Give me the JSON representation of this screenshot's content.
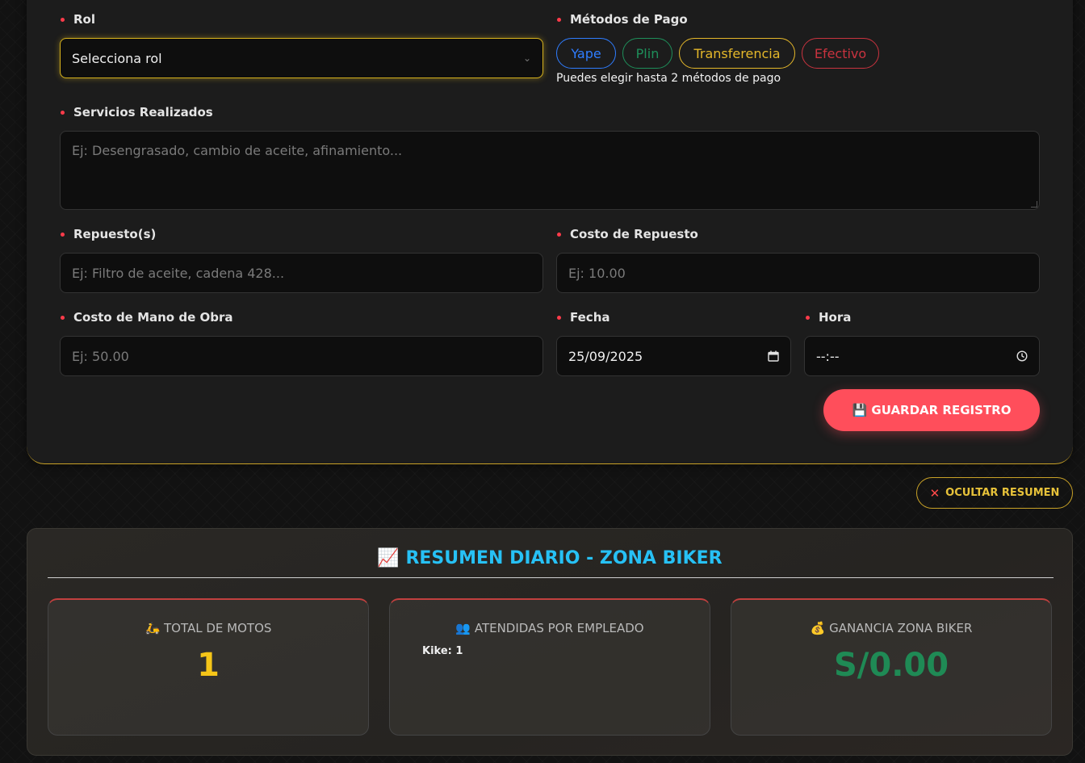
{
  "form": {
    "rol_label": "Rol",
    "rol_value": "Selecciona rol",
    "pago_label": "Métodos de Pago",
    "pago_options": [
      {
        "label": "Yape",
        "color": "#2f7dff"
      },
      {
        "label": "Plin",
        "color": "#1e8f5a"
      },
      {
        "label": "Transferencia",
        "color": "#e5b82a"
      },
      {
        "label": "Efectivo",
        "color": "#c9333f"
      }
    ],
    "pago_hint": "Puedes elegir hasta 2 métodos de pago",
    "servicios_label": "Servicios Realizados",
    "servicios_placeholder": "Ej: Desengrasado, cambio de aceite, afinamiento...",
    "repuesto_label": "Repuesto(s)",
    "repuesto_placeholder": "Ej: Filtro de aceite, cadena 428...",
    "costo_repuesto_label": "Costo de Repuesto",
    "costo_repuesto_placeholder": "Ej: 10.00",
    "mano_obra_label": "Costo de Mano de Obra",
    "mano_obra_placeholder": "Ej: 50.00",
    "fecha_label": "Fecha",
    "fecha_value": "25/09/2025",
    "hora_label": "Hora",
    "hora_value": "--:--",
    "save_label": "💾 GUARDAR REGISTRO"
  },
  "toggle": {
    "label": "OCULTAR RESUMEN",
    "icon": "close-icon"
  },
  "summary": {
    "title": "📈 RESUMEN DIARIO - ZONA BIKER",
    "cards": [
      {
        "title": "🛵 TOTAL DE MOTOS",
        "value": "1",
        "color": "#f5c518"
      },
      {
        "title": "👥 ATENDIDAS POR EMPLEADO",
        "employee": "Kike:",
        "employee_count": "1"
      },
      {
        "title": "💰 GANANCIA ZONA BIKER",
        "value": "S/0.00",
        "color": "#1f8a55"
      }
    ]
  }
}
